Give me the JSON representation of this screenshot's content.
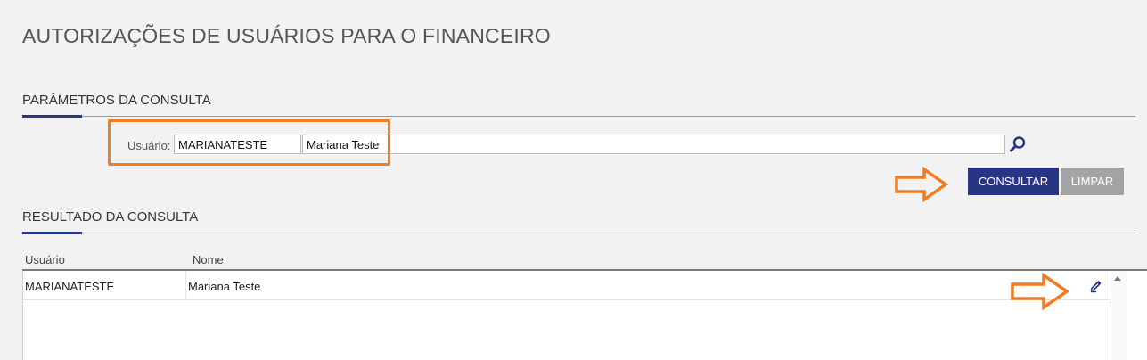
{
  "page_title": "AUTORIZAÇÕES DE USUÁRIOS PARA O FINANCEIRO",
  "params_section": {
    "title": "PARÂMETROS DA CONSULTA",
    "user_label": "Usuário:",
    "user_code_value": "MARIANATESTE",
    "user_name_value": "Mariana Teste",
    "lookup_icon": "search-icon"
  },
  "actions": {
    "consultar_label": "CONSULTAR",
    "limpar_label": "LIMPAR"
  },
  "results_section": {
    "title": "RESULTADO DA CONSULTA",
    "columns": [
      "Usuário",
      "Nome"
    ],
    "rows": [
      {
        "usuario": "MARIANATESTE",
        "nome": "Mariana Teste",
        "action_icon": "edit-pencil-icon"
      }
    ]
  },
  "colors": {
    "primary": "#283583",
    "secondary_button": "#a3a3a3",
    "annotation": "#f47b20"
  }
}
